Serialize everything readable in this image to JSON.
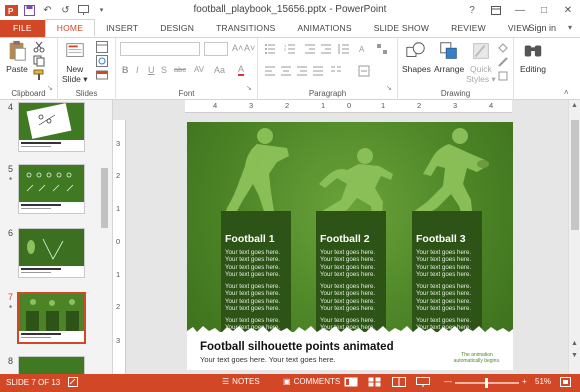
{
  "window": {
    "title": "football_playbook_15656.pptx - PowerPoint",
    "controls": [
      "?",
      "restore",
      "minimize",
      "maximize",
      "close"
    ]
  },
  "tabs": [
    {
      "label": "FILE"
    },
    {
      "label": "HOME"
    },
    {
      "label": "INSERT"
    },
    {
      "label": "DESIGN"
    },
    {
      "label": "TRANSITIONS"
    },
    {
      "label": "ANIMATIONS"
    },
    {
      "label": "SLIDE SHOW"
    },
    {
      "label": "REVIEW"
    },
    {
      "label": "VIEW"
    }
  ],
  "signin": "Sign in",
  "ribbon": {
    "paste": "Paste",
    "new_slide": "New\nSlide",
    "new_slide_line1": "New",
    "new_slide_line2": "Slide ▾",
    "shapes": "Shapes",
    "arrange": "Arrange",
    "quick_styles_line1": "Quick",
    "quick_styles_line2": "Styles ▾",
    "editing": "Editing",
    "groups": {
      "clipboard": "Clipboard",
      "slides": "Slides",
      "font": "Font",
      "paragraph": "Paragraph",
      "drawing": "Drawing"
    },
    "format_buttons": [
      "B",
      "I",
      "U",
      "S",
      "abc",
      "AV",
      "Aa",
      "A"
    ]
  },
  "thumbnails": [
    {
      "number": "4",
      "star": ""
    },
    {
      "number": "5",
      "star": "*"
    },
    {
      "number": "6",
      "star": ""
    },
    {
      "number": "7",
      "star": "*"
    },
    {
      "number": "8",
      "star": ""
    }
  ],
  "ruler": {
    "h": [
      "4",
      "3",
      "2",
      "1",
      "0",
      "1",
      "2",
      "3",
      "4"
    ],
    "v": [
      "3",
      "2",
      "1",
      "0",
      "1",
      "2",
      "3"
    ]
  },
  "slide": {
    "columns": [
      {
        "title": "Football 1",
        "para1": "Your text goes here. Your text goes here. Your text goes here. Your text goes here.",
        "para2": "Your text goes here. Your text goes here. Your text goes here. Your text goes here.",
        "para3": "Your text goes here. Your text goes here."
      },
      {
        "title": "Football 2",
        "para1": "Your text goes here. Your text goes here. Your text goes here. Your text goes here.",
        "para2": "Your text goes here. Your text goes here. Your text goes here. Your text goes here.",
        "para3": "Your text goes here. Your text goes here."
      },
      {
        "title": "Football 3",
        "para1": "Your text goes here. Your text goes here. Your text goes here. Your text goes here.",
        "para2": "Your text goes here. Your text goes here. Your text goes here. Your text goes here.",
        "para3": "Your text goes here. Your text goes here."
      }
    ],
    "title": "Football silhouette points animated",
    "subtitle": "Your text goes here. Your text goes here.",
    "note": "The animation automatically begins."
  },
  "status": {
    "slide_indicator": "SLIDE 7 OF 13",
    "notes": "NOTES",
    "comments": "COMMENTS",
    "zoom": "51%"
  },
  "colors": {
    "accent": "#d24726",
    "slide_green": "#4b8326",
    "panel_green": "#2d5317"
  }
}
